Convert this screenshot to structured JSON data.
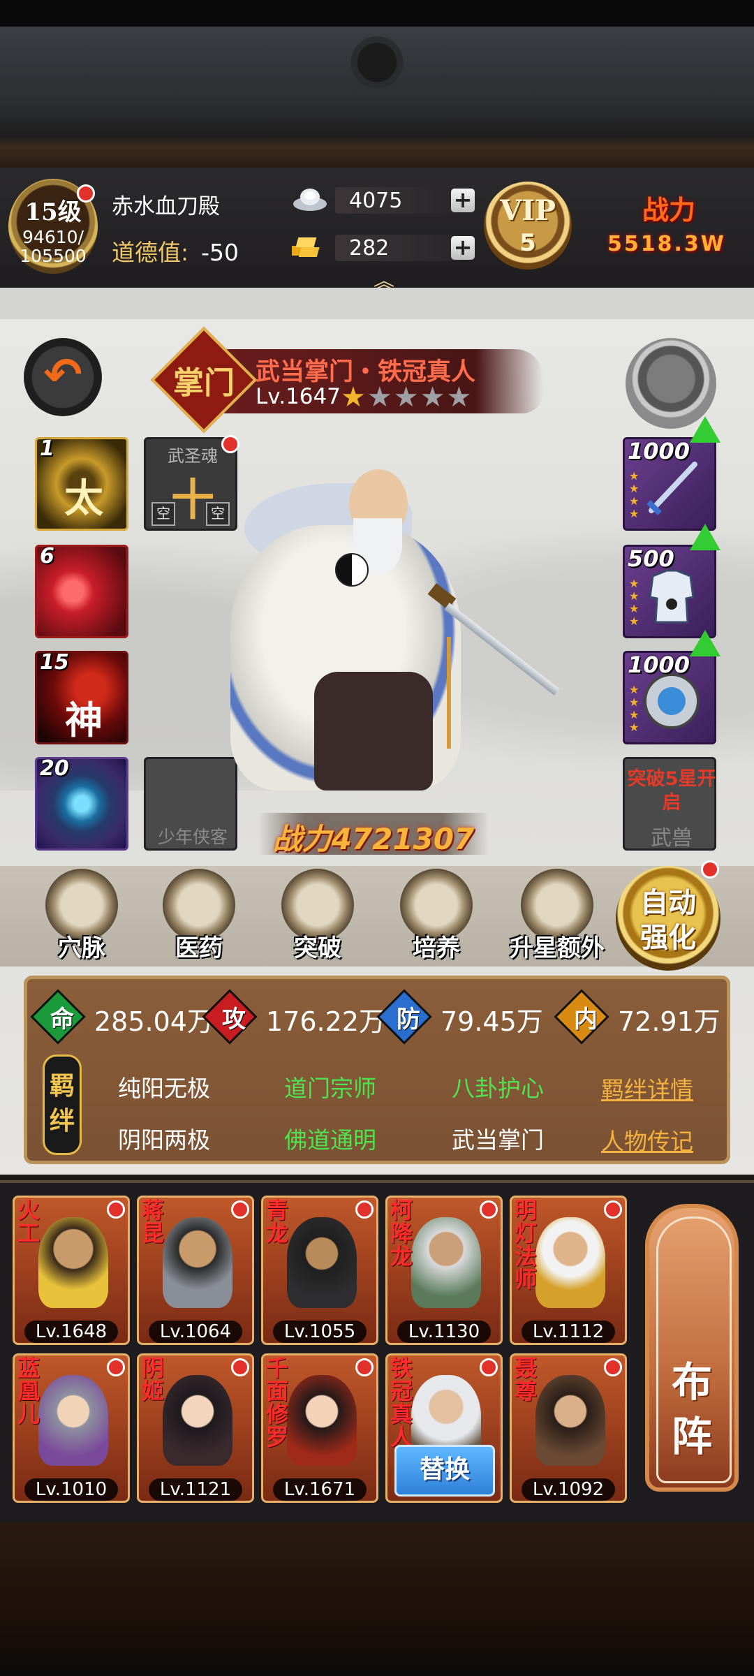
{
  "header": {
    "level": "15级",
    "exp_current": "94610/",
    "exp_max": "105500",
    "player_name": "赤水血刀殿",
    "morality_label": "道德值:",
    "morality_value": "-50",
    "silver": "4075",
    "gold": "282",
    "vip_label": "VIP",
    "vip_level": "5",
    "power_label": "战力",
    "power_value": "5518.3W"
  },
  "hero": {
    "seal": "掌门",
    "title": "武当掌门・铁冠真人",
    "level": "Lv.1647",
    "stars_total": 5,
    "stars_filled": 1,
    "power": "战力4721307"
  },
  "left_slots": {
    "slot1_num": "1",
    "slot1_char": "太",
    "soul_title": "武圣魂",
    "soul_char": "十",
    "soul_empty": "空",
    "slot2_num": "6",
    "slot3_num": "15",
    "slot3_char": "神",
    "slot4_num": "20",
    "empty_label": "少年侠客"
  },
  "right_slots": {
    "weapon_num": "1000",
    "armor_num": "500",
    "accessory_num": "1000",
    "breakthrough_text": "突破5星开启",
    "beast_label": "武兽"
  },
  "functions": [
    {
      "label": "穴脉"
    },
    {
      "label": "医药"
    },
    {
      "label": "突破"
    },
    {
      "label": "培养"
    },
    {
      "label": "升星额外"
    }
  ],
  "auto_enhance": "自动强化",
  "stats": [
    {
      "icon": "命",
      "value": "285.04万",
      "color": "#1a9a3a"
    },
    {
      "icon": "攻",
      "value": "176.22万",
      "color": "#c81e22"
    },
    {
      "icon": "防",
      "value": "79.45万",
      "color": "#2a6ed0"
    },
    {
      "icon": "内",
      "value": "72.91万",
      "color": "#d88a12"
    }
  ],
  "bonds": {
    "tag": "羁绊",
    "row1": [
      "纯阳无极",
      "道门宗师",
      "八卦护心"
    ],
    "row2": [
      "阴阳两极",
      "佛道通明",
      "武当掌门"
    ],
    "details_link": "羁绊详情",
    "biography_link": "人物传记"
  },
  "roster": [
    {
      "name": "火工",
      "level": "Lv.1648"
    },
    {
      "name": "蒋昆",
      "level": "Lv.1064"
    },
    {
      "name": "青龙",
      "level": "Lv.1055"
    },
    {
      "name": "柯降龙",
      "level": "Lv.1130"
    },
    {
      "name": "明灯法师",
      "level": "Lv.1112"
    },
    {
      "name": "蓝凰儿",
      "level": "Lv.1010"
    },
    {
      "name": "阴姬",
      "level": "Lv.1121"
    },
    {
      "name": "千面修罗",
      "level": "Lv.1671"
    },
    {
      "name": "铁冠真人",
      "level": ""
    },
    {
      "name": "聂尊",
      "level": "Lv.1092"
    }
  ],
  "swap_label": "替换",
  "formation_label": "布阵"
}
